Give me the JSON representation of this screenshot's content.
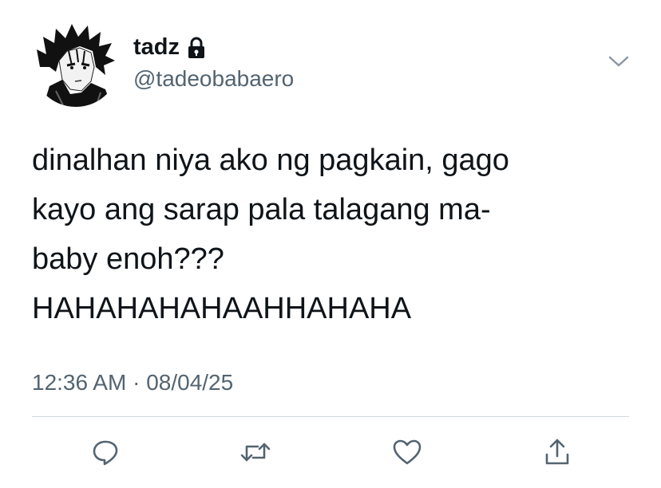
{
  "author": {
    "display_name": "tadz",
    "handle": "@tadeobabaero",
    "protected": true
  },
  "tweet": {
    "text": "dinalhan niya ako ng pagkain, gago\nkayo ang sarap pala talagang ma-\nbaby enoh???\nHAHAHAHAHAAHHAHAHA",
    "time": "12:36 AM",
    "separator": "·",
    "date": "08/04/25"
  },
  "icons": {
    "avatar": "anime-avatar",
    "lock": "lock-icon",
    "menu": "chevron-down-icon",
    "reply": "reply-icon",
    "retweet": "retweet-icon",
    "like": "heart-icon",
    "share": "share-icon"
  },
  "colors": {
    "text": "#0f1419",
    "secondary": "#536471",
    "divider": "#cfd9de",
    "action_icon": "#536471"
  }
}
